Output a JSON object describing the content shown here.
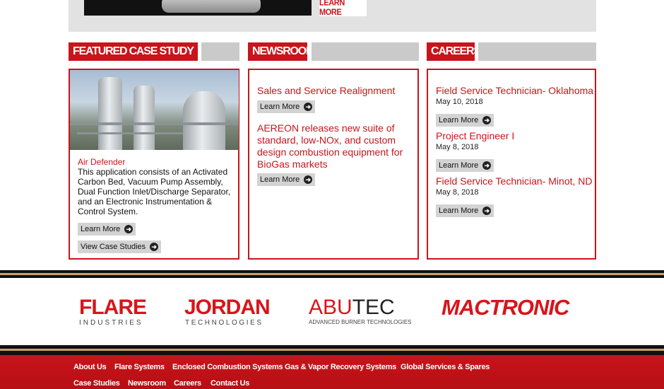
{
  "banner": {
    "learn_more": "LEARN MORE"
  },
  "sections": {
    "case_study": {
      "title": "FEATURED CASE STUDY",
      "item_title": "Air Defender",
      "description": "This application consists of an Activated Carbon Bed, Vacuum Pump Assembly, Dual Function Inlet/Discharge Separator, and an Electronic Instrumentation & Control System.",
      "learn_more": "Learn More",
      "view_case_studies": "View Case Studies"
    },
    "newsroom": {
      "title": "NEWSROOM",
      "items": [
        {
          "title": "Sales and Service Realignment",
          "button": "Learn More"
        },
        {
          "title": "AEREON releases new suite of standard, low-NOx, and custom design combustion equipment for BioGas markets",
          "button": "Learn More"
        }
      ]
    },
    "careers": {
      "title": "CAREERS",
      "items": [
        {
          "title": "Field Service Technician- Oklahoma",
          "date": "May 10, 2018",
          "button": "Learn More"
        },
        {
          "title": "Project Engineer I",
          "date": "May 8, 2018",
          "button": "Learn More"
        },
        {
          "title": "Field Service Technician- Minot, ND",
          "date": "May 8, 2018",
          "button": "Learn More"
        }
      ]
    }
  },
  "logos": {
    "flare": {
      "name": "FLARE",
      "sub": "INDUSTRIES"
    },
    "jordan": {
      "name": "JORDAN",
      "sub": "TECHNOLOGIES"
    },
    "abutec": {
      "name_a": "ABU",
      "name_b": "TEC",
      "sub": "ADVANCED BURNER TECHNOLOGIES"
    },
    "mactronic": {
      "name": "MACTRONIC"
    }
  },
  "footer": {
    "row1": [
      "About Us",
      "Flare Systems",
      "Enclosed Combustion Systems",
      "Gas & Vapor Recovery Systems",
      "Global Services & Spares"
    ],
    "row2": [
      "Case Studies",
      "Newsroom",
      "Careers",
      "Contact Us"
    ]
  },
  "colors": {
    "brand_red": "#c8151b",
    "header_gray": "#cacaca",
    "button_gray": "#d3d3d3"
  },
  "icons": {
    "arrow": "arrow-right-circle-icon"
  }
}
